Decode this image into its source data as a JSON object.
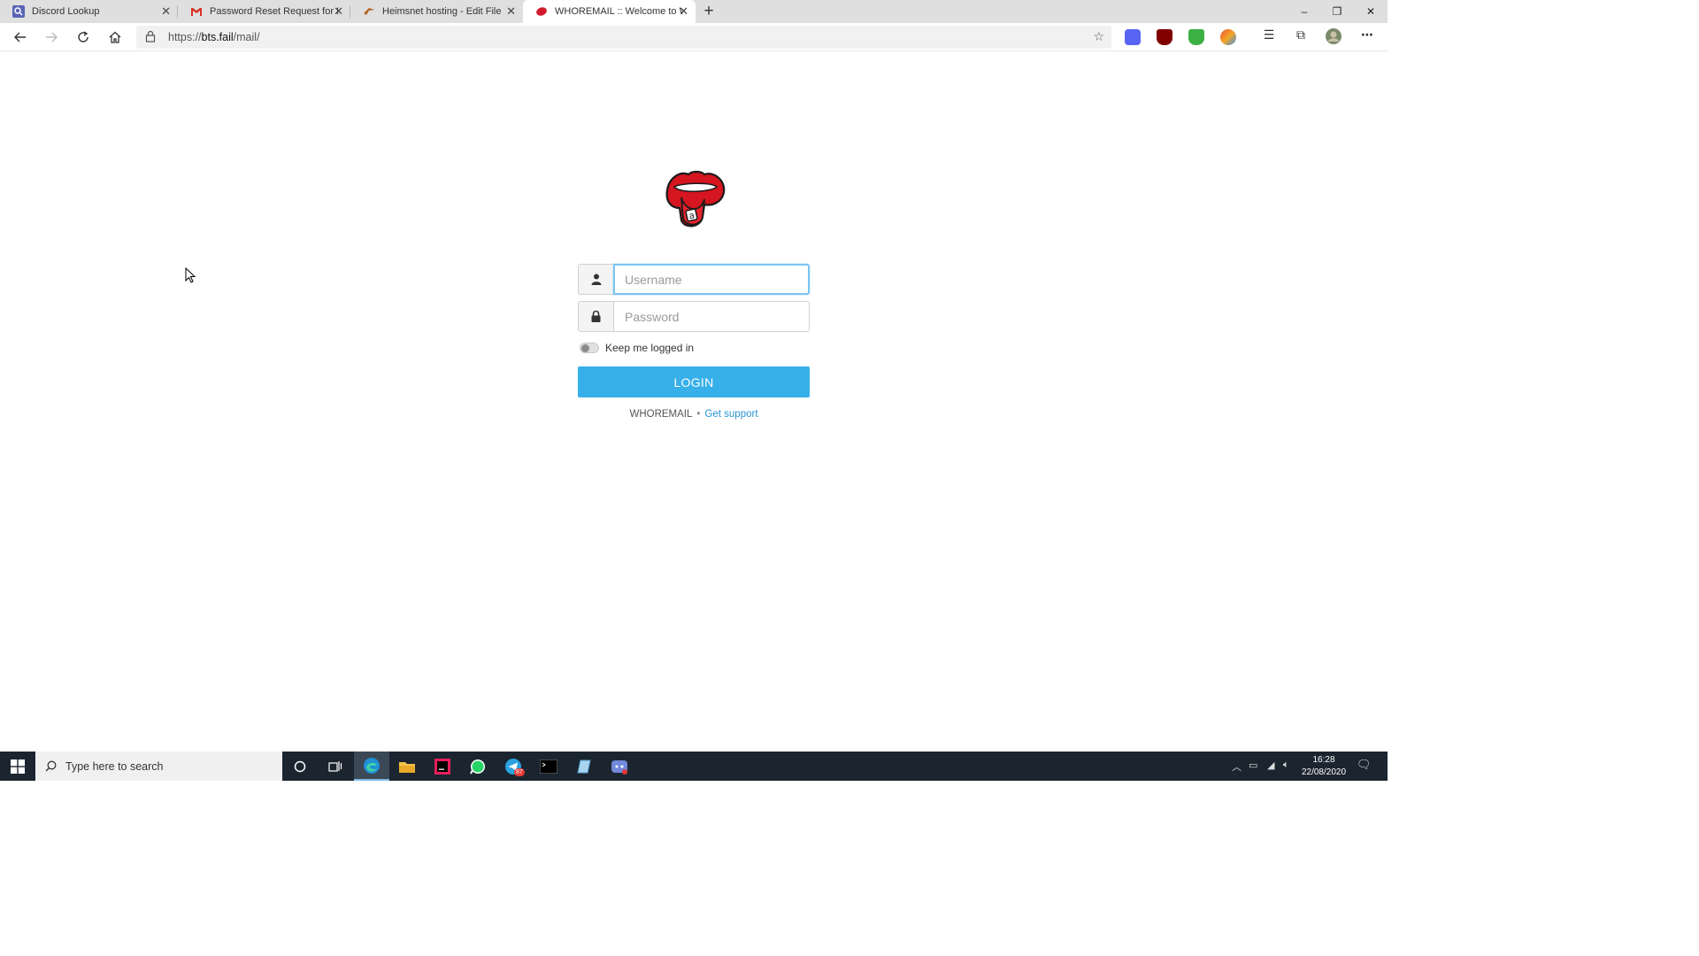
{
  "browser": {
    "tabs": [
      {
        "title": "Discord Lookup",
        "favicon": "discord-lookup-icon",
        "active": false
      },
      {
        "title": "Password Reset Request for Disc",
        "favicon": "gmail-icon",
        "active": false
      },
      {
        "title": "Heimsnet hosting - Edit File",
        "favicon": "heimsnet-icon",
        "active": false
      },
      {
        "title": "WHOREMAIL :: Welcome to WHC",
        "favicon": "whoremail-lips-icon",
        "active": true
      }
    ],
    "url_prefix": "https://",
    "url_domain": "bts.fail",
    "url_path": "/mail/",
    "extensions": [
      "discord-ext-icon",
      "ublock-icon",
      "shield-ext-icon",
      "colorful-ext-icon"
    ]
  },
  "page": {
    "username_placeholder": "Username",
    "password_placeholder": "Password",
    "remember_label": "Keep me logged in",
    "login_label": "LOGIN",
    "brand": "WHOREMAIL",
    "separator": "•",
    "support_label": "Get support",
    "accent_color": "#37b0ea"
  },
  "taskbar": {
    "search_placeholder": "Type here to search",
    "time": "16:28",
    "date": "22/08/2020",
    "telegram_badge": "87",
    "apps": [
      "cortana-icon",
      "task-view-icon",
      "edge-icon",
      "file-explorer-icon",
      "jetbrains-icon",
      "whatsapp-icon",
      "telegram-icon",
      "terminal-icon",
      "notepad-icon",
      "discord-icon"
    ]
  }
}
